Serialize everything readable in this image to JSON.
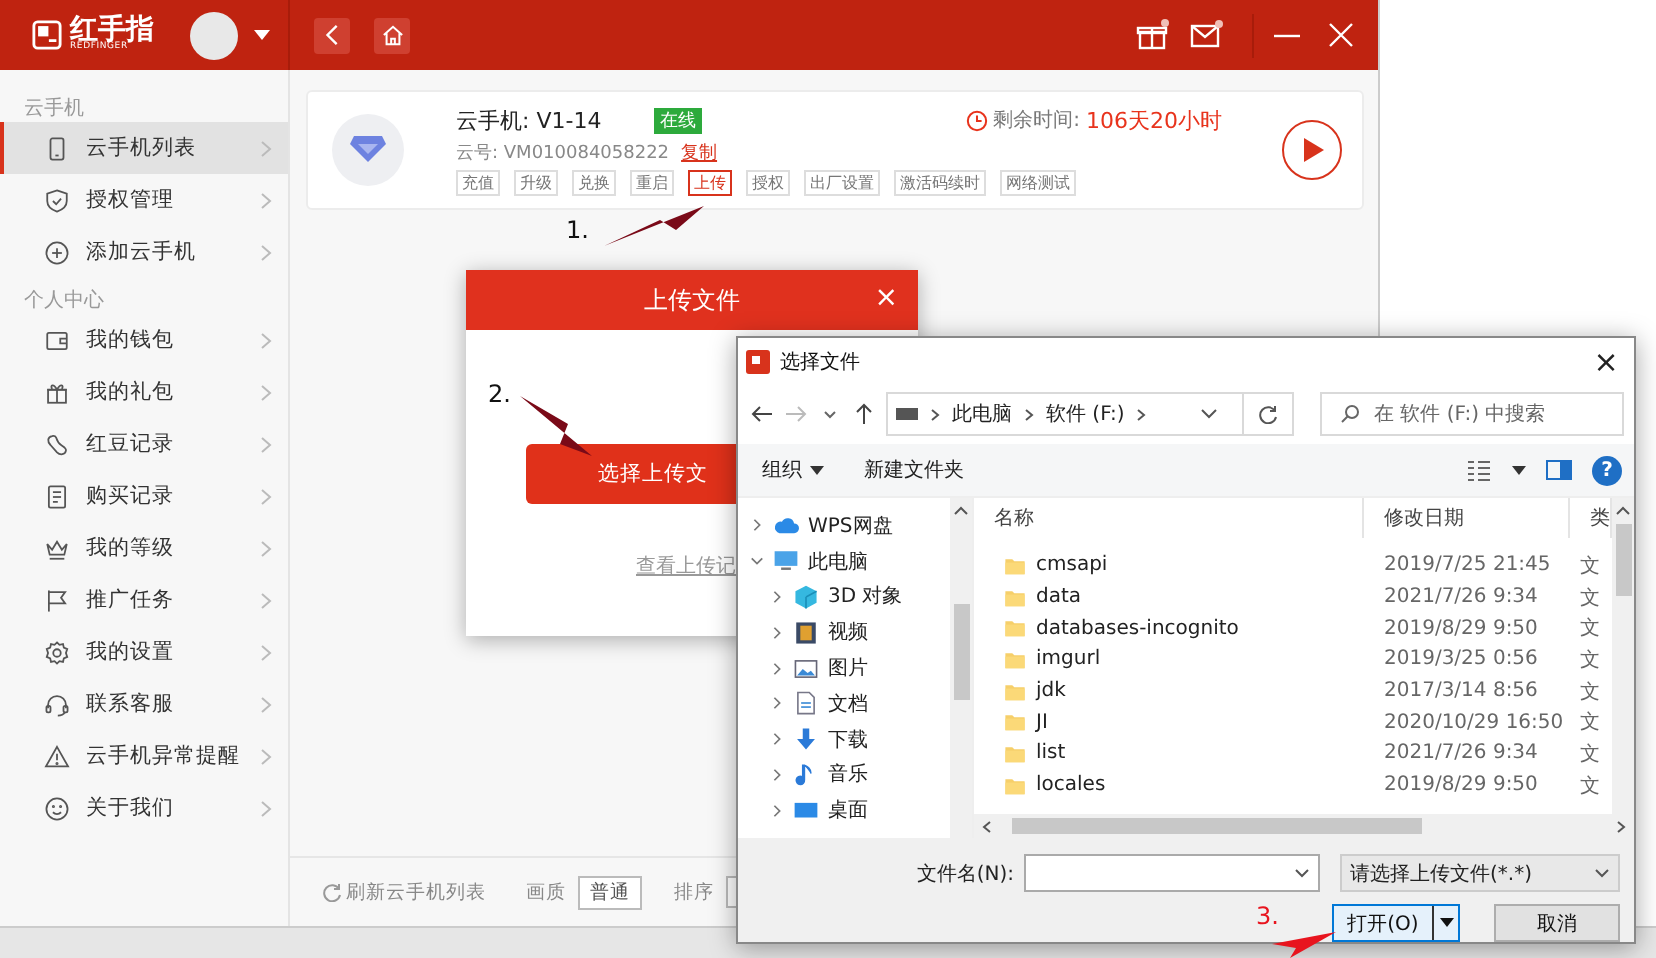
{
  "app": {
    "logo": {
      "name": "红手指",
      "subtitle": "REDFINGER"
    },
    "sidebar": {
      "sections": [
        {
          "title": "云手机",
          "items": [
            {
              "label": "云手机列表",
              "selected": true
            },
            {
              "label": "授权管理",
              "selected": false
            },
            {
              "label": "添加云手机",
              "selected": false
            }
          ]
        },
        {
          "title": "个人中心",
          "items": [
            {
              "label": "我的钱包",
              "selected": false
            },
            {
              "label": "我的礼包",
              "selected": false
            },
            {
              "label": "红豆记录",
              "selected": false
            },
            {
              "label": "购买记录",
              "selected": false
            },
            {
              "label": "我的等级",
              "selected": false
            },
            {
              "label": "推广任务",
              "selected": false
            },
            {
              "label": "我的设置",
              "selected": false
            },
            {
              "label": "联系客服",
              "selected": false
            },
            {
              "label": "云手机异常提醒",
              "selected": false
            },
            {
              "label": "关于我们",
              "selected": false
            }
          ]
        }
      ]
    },
    "phone_card": {
      "name": "云手机: V1-14",
      "status": "在线",
      "id_label": "云号: VM010084058222",
      "copy_link": "复制",
      "remaining_label": "剩余时间:",
      "remaining_value": "106天20小时",
      "actions": [
        {
          "label": "充值",
          "selected": false
        },
        {
          "label": "升级",
          "selected": false
        },
        {
          "label": "兑换",
          "selected": false
        },
        {
          "label": "重启",
          "selected": false
        },
        {
          "label": "上传",
          "selected": true
        },
        {
          "label": "授权",
          "selected": false
        },
        {
          "label": "出厂设置",
          "selected": false
        },
        {
          "label": "激活码续时",
          "selected": false
        },
        {
          "label": "网络测试",
          "selected": false
        }
      ]
    },
    "bottom_bar": {
      "refresh": "刷新云手机列表",
      "quality_label": "画质",
      "quality_value": "普通",
      "sort_label": "排序"
    }
  },
  "upload_dialog": {
    "title": "上传文件",
    "close": "×",
    "button": "选择上传文",
    "link": "查看上传记"
  },
  "file_dialog": {
    "title": "选择文件",
    "close": "×",
    "path": [
      "此电脑",
      "软件 (F:)"
    ],
    "search": {
      "placeholder": "在 软件 (F:) 中搜索"
    },
    "toolbar": {
      "organize": "组织",
      "new_folder": "新建文件夹",
      "help": "?"
    },
    "nav": [
      {
        "label": "WPS网盘",
        "expanded": false
      },
      {
        "label": "此电脑",
        "expanded": true,
        "children": [
          {
            "label": "3D 对象",
            "expanded": false
          },
          {
            "label": "视频",
            "expanded": false
          },
          {
            "label": "图片",
            "expanded": false
          },
          {
            "label": "文档",
            "expanded": false
          },
          {
            "label": "下载",
            "expanded": false
          },
          {
            "label": "音乐",
            "expanded": false
          },
          {
            "label": "桌面",
            "expanded": false
          }
        ]
      }
    ],
    "columns": [
      "名称",
      "修改日期",
      "类"
    ],
    "rows": [
      {
        "name": "cmsapi",
        "date": "2019/7/25 21:45",
        "type": "文"
      },
      {
        "name": "data",
        "date": "2021/7/26 9:34",
        "type": "文"
      },
      {
        "name": "databases-incognito",
        "date": "2019/8/29 9:50",
        "type": "文"
      },
      {
        "name": "imgurl",
        "date": "2019/3/25 0:56",
        "type": "文"
      },
      {
        "name": "jdk",
        "date": "2017/3/14 8:56",
        "type": "文"
      },
      {
        "name": "JI",
        "date": "2020/10/29 16:50",
        "type": "文"
      },
      {
        "name": "list",
        "date": "2021/7/26 9:34",
        "type": "文"
      },
      {
        "name": "locales",
        "date": "2019/8/29 9:50",
        "type": "文"
      }
    ],
    "filename_label": "文件名(N):",
    "filter": "请选择上传文件(*.*)",
    "open_button": "打开(O)",
    "cancel_button": "取消"
  },
  "annotations": [
    {
      "label": "1.",
      "color": "#111111"
    },
    {
      "label": "2.",
      "color": "#111111"
    },
    {
      "label": "3.",
      "color": "#e8141e"
    }
  ]
}
